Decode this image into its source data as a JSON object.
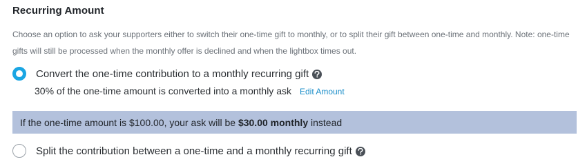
{
  "section": {
    "title": "Recurring Amount",
    "description": "Choose an option to ask your supporters either to switch their one-time gift to monthly, or to split their gift between one-time and monthly. Note: one-time gifts will still be processed when the monthly offer is declined and when the lightbox times out."
  },
  "options": [
    {
      "label": "Convert the one-time contribution to a monthly recurring gift",
      "selected": true,
      "help_icon": "question-circle-icon",
      "detail": "30% of the one-time amount is converted into a monthly ask",
      "action_label": "Edit Amount"
    },
    {
      "label": "Split the contribution between a one-time and a monthly recurring gift",
      "selected": false,
      "help_icon": "question-circle-icon"
    }
  ],
  "banner": {
    "prefix": "If the one-time amount is $100.00, your ask will be ",
    "emphasis": "$30.00 monthly",
    "suffix": " instead"
  },
  "colors": {
    "accent": "#1ba6e3",
    "link": "#1b8ec9",
    "banner_bg": "#b3c1dc"
  }
}
